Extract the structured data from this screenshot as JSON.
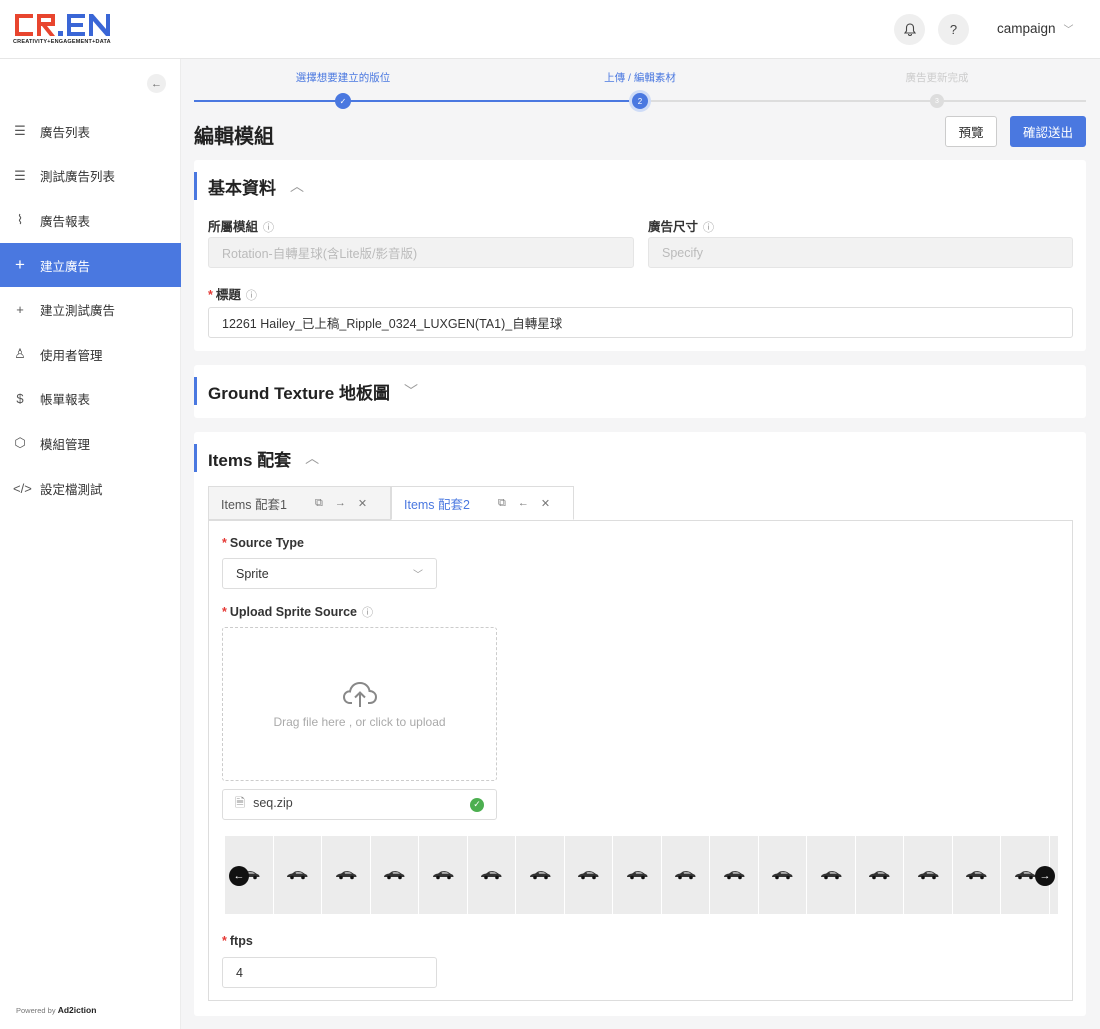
{
  "brand": {
    "logo_text": "CR.EN",
    "tagline": "CREATIVITY+ENGAGEMENT+DATA",
    "colors": {
      "red": "#e8452e",
      "blue": "#3a66d6"
    }
  },
  "header": {
    "notification_icon": "bell-icon",
    "help_label": "?",
    "user": "campaign"
  },
  "sidebar": {
    "collapse_icon": "arrow-left-icon",
    "items": [
      {
        "label": "廣告列表",
        "icon": "list-icon"
      },
      {
        "label": "測試廣告列表",
        "icon": "test-list-icon"
      },
      {
        "label": "廣告報表",
        "icon": "pulse-icon"
      },
      {
        "label": "建立廣告",
        "icon": "plus-icon",
        "active": true
      },
      {
        "label": "建立測試廣告",
        "icon": "plus-test-icon"
      },
      {
        "label": "使用者管理",
        "icon": "user-icon"
      },
      {
        "label": "帳單報表",
        "icon": "dollar-icon"
      },
      {
        "label": "模組管理",
        "icon": "cube-icon"
      },
      {
        "label": "設定檔測試",
        "icon": "code-icon"
      }
    ],
    "powered_by": "Powered by",
    "powered_brand": "Ad2iction"
  },
  "stepper": {
    "steps": [
      {
        "label": "選擇想要建立的版位",
        "marker": "✓",
        "state": "done"
      },
      {
        "label": "上傳 / 編輯素材",
        "marker": "2",
        "state": "current"
      },
      {
        "label": "廣告更新完成",
        "marker": "3",
        "state": "pending"
      }
    ]
  },
  "page": {
    "title": "編輯模組",
    "preview_label": "預覽",
    "submit_label": "確認送出"
  },
  "basic": {
    "title": "基本資料",
    "module_label": "所屬模組",
    "module_value": "Rotation-自轉星球(含Lite版/影音版)",
    "size_label": "廣告尺寸",
    "size_value": "Specify",
    "title_label": "標題",
    "title_value": "12261 Hailey_已上稿_Ripple_0324_LUXGEN(TA1)_自轉星球"
  },
  "ground": {
    "title": "Ground Texture 地板圖"
  },
  "items": {
    "title": "Items 配套",
    "tabs": [
      {
        "label": "Items 配套1",
        "active": false
      },
      {
        "label": "Items 配套2",
        "active": true
      }
    ],
    "source_type_label": "Source Type",
    "source_type_value": "Sprite",
    "upload_label": "Upload Sprite Source",
    "upload_hint": "Drag file here , or click to upload",
    "file_name": "seq.zip",
    "frame_count": 18,
    "ftps_label": "ftps",
    "ftps_value": "4"
  }
}
